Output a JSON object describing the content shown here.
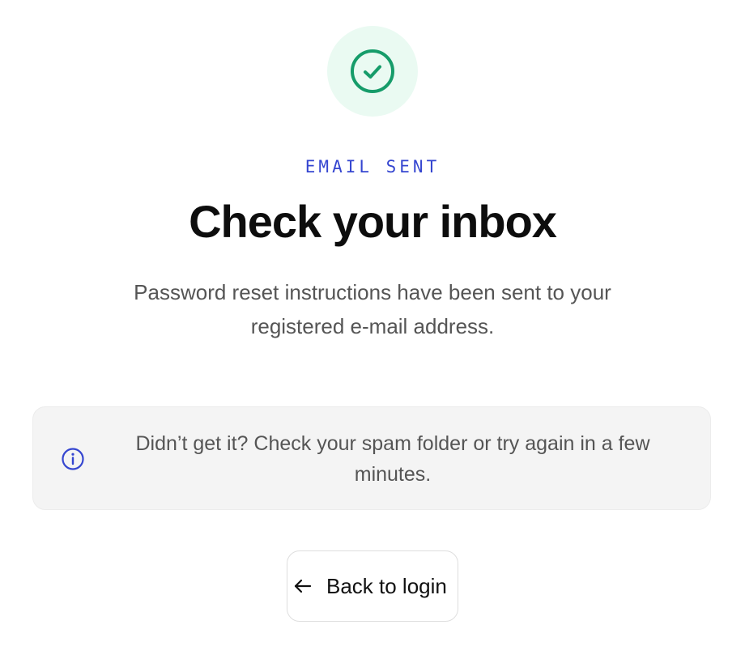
{
  "status": {
    "icon": "check-circle-icon",
    "icon_color": "#169c6a",
    "background_color": "#eafaf2"
  },
  "eyebrow": "EMAIL SENT",
  "title": "Check your inbox",
  "description": "Password reset instructions have been sent to your registered e-mail address.",
  "notice": {
    "icon": "info-icon",
    "icon_color": "#3546d0",
    "text": "Didn’t get it? Check your spam folder or try again in a few minutes."
  },
  "back_button": {
    "icon": "arrow-left-icon",
    "label": "Back to login"
  },
  "colors": {
    "accent": "#3546d0",
    "success": "#169c6a"
  }
}
